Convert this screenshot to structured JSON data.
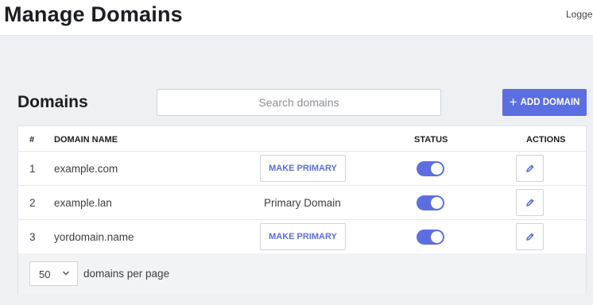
{
  "header": {
    "title": "Manage Domains",
    "user_text": "Logged"
  },
  "domains": {
    "section_title": "Domains",
    "search_placeholder": "Search domains",
    "add_button_label": "ADD DOMAIN",
    "add_button_icon": "plus-icon"
  },
  "table": {
    "headers": {
      "num": "#",
      "domain_name": "DOMAIN NAME",
      "status": "STATUS",
      "actions": "ACTIONS"
    },
    "rows": [
      {
        "num": "1",
        "domain": "example.com",
        "primary_text": "",
        "action_label": "MAKE PRIMARY",
        "status_enabled": true
      },
      {
        "num": "2",
        "domain": "example.lan",
        "primary_text": "Primary Domain",
        "action_label": "",
        "status_enabled": true
      },
      {
        "num": "3",
        "domain": "yordomain.name",
        "primary_text": "",
        "action_label": "MAKE PRIMARY",
        "status_enabled": true
      }
    ]
  },
  "pagination": {
    "per_page_value": "50",
    "per_page_label": "domains per page"
  },
  "colors": {
    "accent": "#5b6fe0",
    "background": "#eef0f3"
  }
}
